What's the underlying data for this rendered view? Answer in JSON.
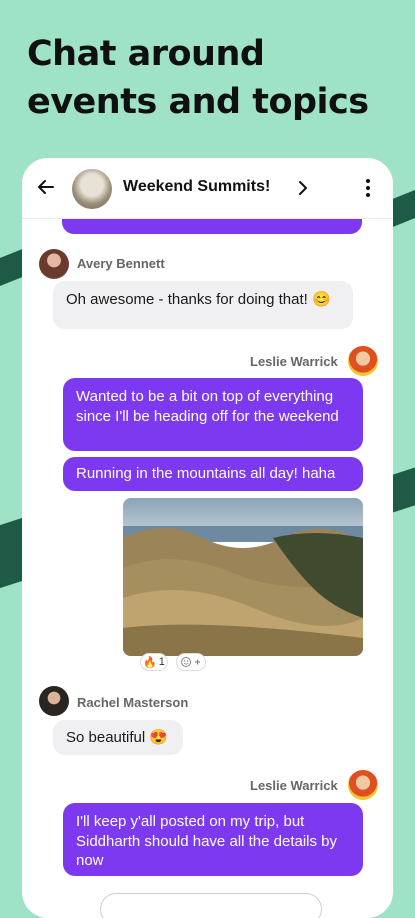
{
  "headline": "Chat around events and topics",
  "header": {
    "title": "Weekend Summits!"
  },
  "messages": {
    "avery_name": "Avery Bennett",
    "avery_text": "Oh awesome - thanks for doing that! 😊",
    "leslie_name_1": "Leslie Warrick",
    "leslie_text_1": "Wanted to be a bit on top of everything since I'll be heading off for the weekend",
    "leslie_text_2": "Running in the mountains all day! haha",
    "photo_reaction_emoji": "🔥",
    "photo_reaction_count": "1",
    "rachel_name": "Rachel Masterson",
    "rachel_text": "So beautiful 😍",
    "leslie_name_2": "Leslie Warrick",
    "leslie_text_3": "I'll keep y'all posted on my trip, but Siddharth should have all the details by now"
  },
  "colors": {
    "background": "#9fe3c7",
    "accent_stripes": "#1e5a46",
    "sent_bubble": "#7c39f0",
    "received_bubble": "#f0f0f2"
  }
}
